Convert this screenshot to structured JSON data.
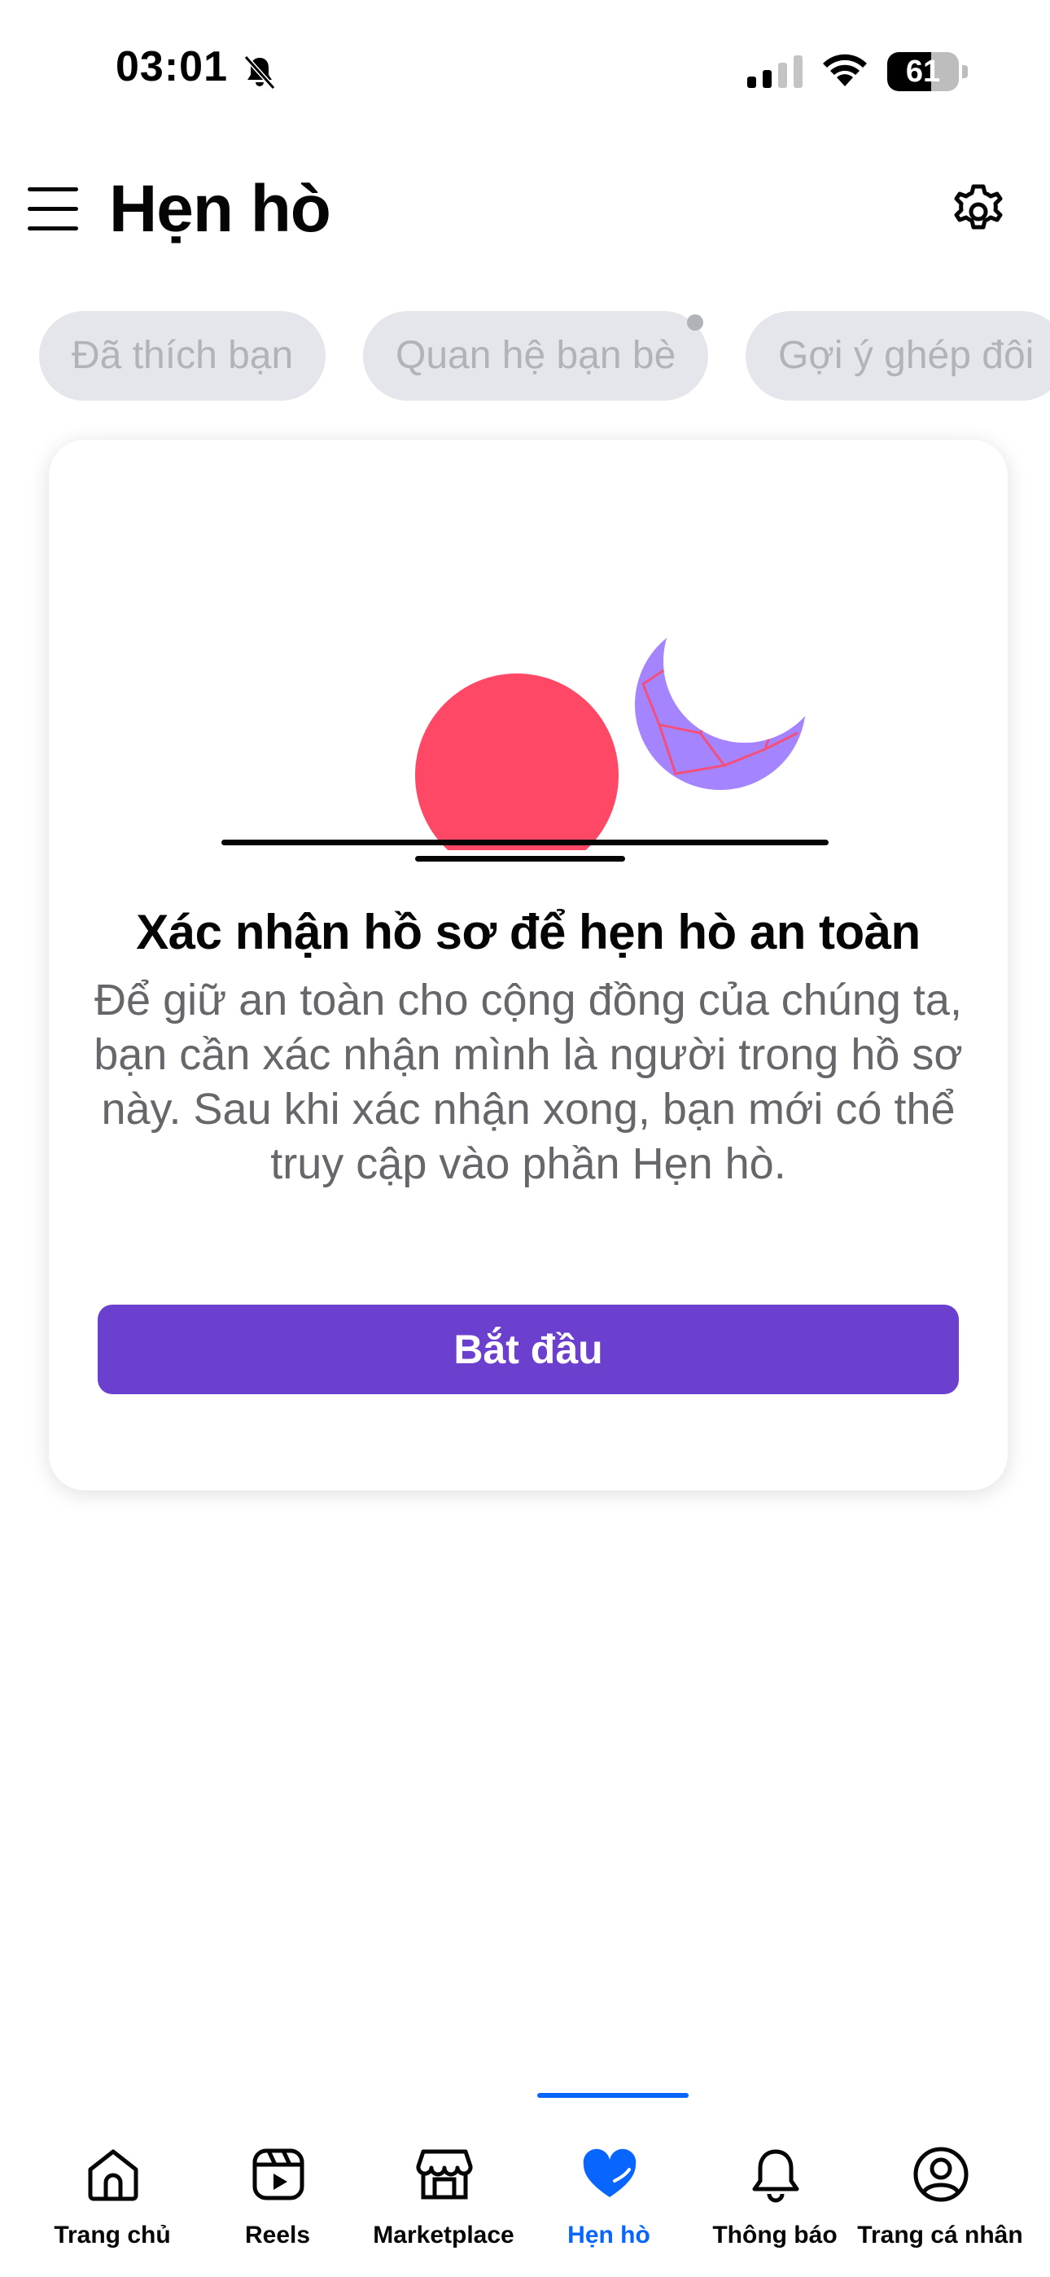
{
  "status_bar": {
    "time": "03:01",
    "battery_level": "61",
    "battery_fraction": 0.61,
    "icons": [
      "bell-muted-icon",
      "signal-icon",
      "wifi-icon",
      "battery-icon"
    ]
  },
  "header": {
    "title": "Hẹn hò",
    "menu_icon": "menu-icon",
    "settings_icon": "gear-icon"
  },
  "chips": [
    {
      "label": "Đã thích bạn",
      "has_dot": false
    },
    {
      "label": "Quan hệ bạn bè",
      "has_dot": true
    },
    {
      "label": "Gợi ý ghép đôi",
      "has_dot": false
    }
  ],
  "card": {
    "title": "Xác nhận hồ sơ để hẹn hò an toàn",
    "description": "Để giữ an toàn cho cộng đồng của chúng ta, bạn cần xác nhận mình là người trong hồ sơ này. Sau khi xác nhận xong, bạn mới có thể truy cập vào phần Hẹn hò.",
    "button_label": "Bắt đầu"
  },
  "colors": {
    "accent_purple": "#6b40cf",
    "sun_red": "#ff4866",
    "moon_purple": "#a584ff",
    "nav_active_blue": "#0866ff",
    "chip_bg": "#e4e6eb",
    "chip_text": "#b0b3b8"
  },
  "bottom_nav": {
    "active_index": 3,
    "items": [
      {
        "label": "Trang chủ",
        "icon": "home-icon"
      },
      {
        "label": "Reels",
        "icon": "reels-icon"
      },
      {
        "label": "Marketplace",
        "icon": "marketplace-icon"
      },
      {
        "label": "Hẹn hò",
        "icon": "heart-icon"
      },
      {
        "label": "Thông báo",
        "icon": "bell-icon"
      },
      {
        "label": "Trang cá nhân",
        "icon": "profile-icon"
      }
    ]
  }
}
